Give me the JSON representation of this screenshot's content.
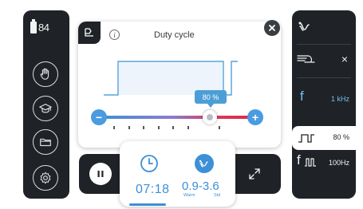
{
  "status": {
    "battery_level": "84"
  },
  "left_sidebar": {
    "buttons": [
      {
        "icon": "hand-icon"
      },
      {
        "icon": "graduation-cap-icon"
      },
      {
        "icon": "folder-icon"
      },
      {
        "icon": "gear-icon"
      }
    ]
  },
  "card": {
    "title": "Duty cycle",
    "info_label": "i",
    "value_badge": "80 %",
    "slider": {
      "value_percent": 80,
      "min_button": "−",
      "max_button": "+",
      "tick_count": 7
    }
  },
  "right_sidebar": {
    "mode_icon": "wave-icon",
    "collapse_icon": "cable-icon",
    "close_label": "×",
    "rows": [
      {
        "symbol": "f",
        "value": "1 kHz"
      },
      {
        "symbol": "⎍",
        "value": "80 %"
      },
      {
        "symbol": "f⎍",
        "value": "100Hz"
      }
    ]
  },
  "bottom": {
    "timer_value": "07:18",
    "range_value": "0.9-3.6",
    "range_labels": [
      "Warm",
      "Std"
    ],
    "timer_progress": 0.35
  },
  "colors": {
    "accent": "#3d8fd6",
    "panel": "#1f2327",
    "slider_end": "#e8204a"
  }
}
